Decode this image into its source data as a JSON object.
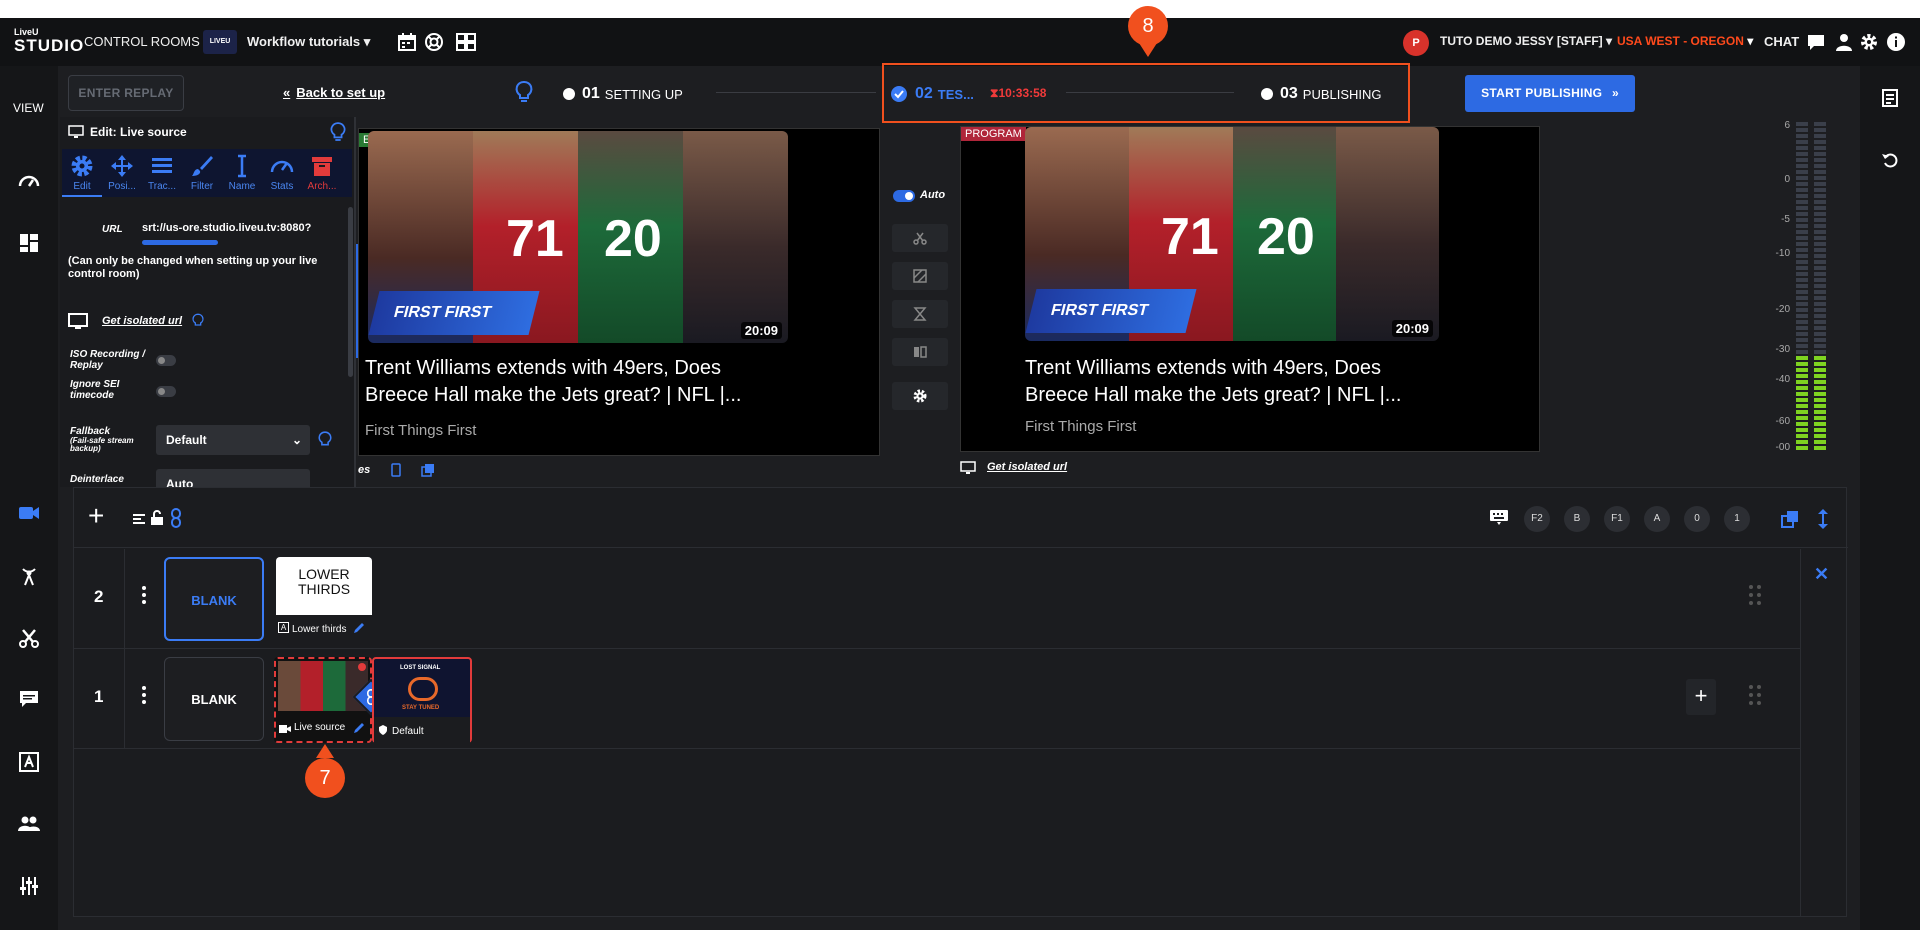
{
  "topbar": {
    "logo_top": "LiveU",
    "logo_bottom": "STUDIO",
    "control_rooms": "CONTROL ROOMS",
    "workspace_badge": "LIVEU",
    "workspace_name": "Workflow tutorials",
    "user_initial": "P",
    "user_name": "TUTO DEMO JESSY [STAFF]",
    "region": "USA WEST - OREGON",
    "chat": "CHAT"
  },
  "leftbar": {
    "view_label": "VIEW"
  },
  "actions": {
    "enter_replay": "ENTER REPLAY",
    "back_to_setup": "Back to set up",
    "start_publishing": "START PUBLISHING"
  },
  "steps": [
    {
      "num": "01",
      "label": "SETTING UP"
    },
    {
      "num": "02",
      "label": "TES..."
    },
    {
      "num": "03",
      "label": "PUBLISHING"
    }
  ],
  "timer": "10:33:58",
  "callouts": {
    "top": "8",
    "bottom": "7"
  },
  "edit_panel": {
    "title": "Edit: Live source",
    "tabs": [
      "Edit",
      "Posi...",
      "Trac...",
      "Filter",
      "Name",
      "Stats",
      "Arch..."
    ],
    "url_label": "URL",
    "url_value": "srt://us-ore.studio.liveu.tv:8080?",
    "url_note": "(Can only be changed when setting up your live control room)",
    "isolated_url": "Get isolated url",
    "iso_recording": "ISO Recording / Replay",
    "ignore_sei": "Ignore SEI timecode",
    "fallback_label": "Fallback",
    "fallback_sub": "(Fail-safe stream backup)",
    "fallback_value": "Default",
    "deinterlace_label": "Deinterlace",
    "deinterlace_value": "Auto"
  },
  "preview": {
    "tag": "EW",
    "video_title": "Trent Williams extends with 49ers, Does Breece Hall make the Jets great? | NFL |...",
    "channel": "First Things First",
    "duration": "20:09",
    "footer_label": "es"
  },
  "program": {
    "tag": "PROGRAM",
    "video_title": "Trent Williams extends with 49ers, Does Breece Hall make the Jets great? | NFL |...",
    "channel": "First Things First",
    "duration": "20:09",
    "isolated_url": "Get isolated url"
  },
  "transition": {
    "auto_label": "Auto"
  },
  "meter_scale": [
    "6",
    "0",
    "-5",
    "-10",
    "-20",
    "-30",
    "-40",
    "-60",
    "-00"
  ],
  "meter_level_fraction": 0.3,
  "scenes_toolbar": {
    "shortcut_keys": [
      "F2",
      "B",
      "F1",
      "A",
      "0",
      "1"
    ]
  },
  "rows": [
    {
      "num": "2",
      "blank_label": "BLANK",
      "items": [
        {
          "title": "LOWER THIRDS",
          "label": "Lower thirds"
        }
      ]
    },
    {
      "num": "1",
      "blank_label": "BLANK",
      "items": [
        {
          "label": "Live source"
        },
        {
          "label": "Default",
          "badge_top": "LOST SIGNAL",
          "badge_bottom": "STAY TUNED"
        }
      ]
    }
  ],
  "colors": {
    "accent": "#2d6ae3",
    "highlight": "#f1501e",
    "region": "#ff4a1c",
    "alert": "#f03a3a",
    "program_tag": "#b0263a",
    "meter_green": "#7ed321"
  }
}
